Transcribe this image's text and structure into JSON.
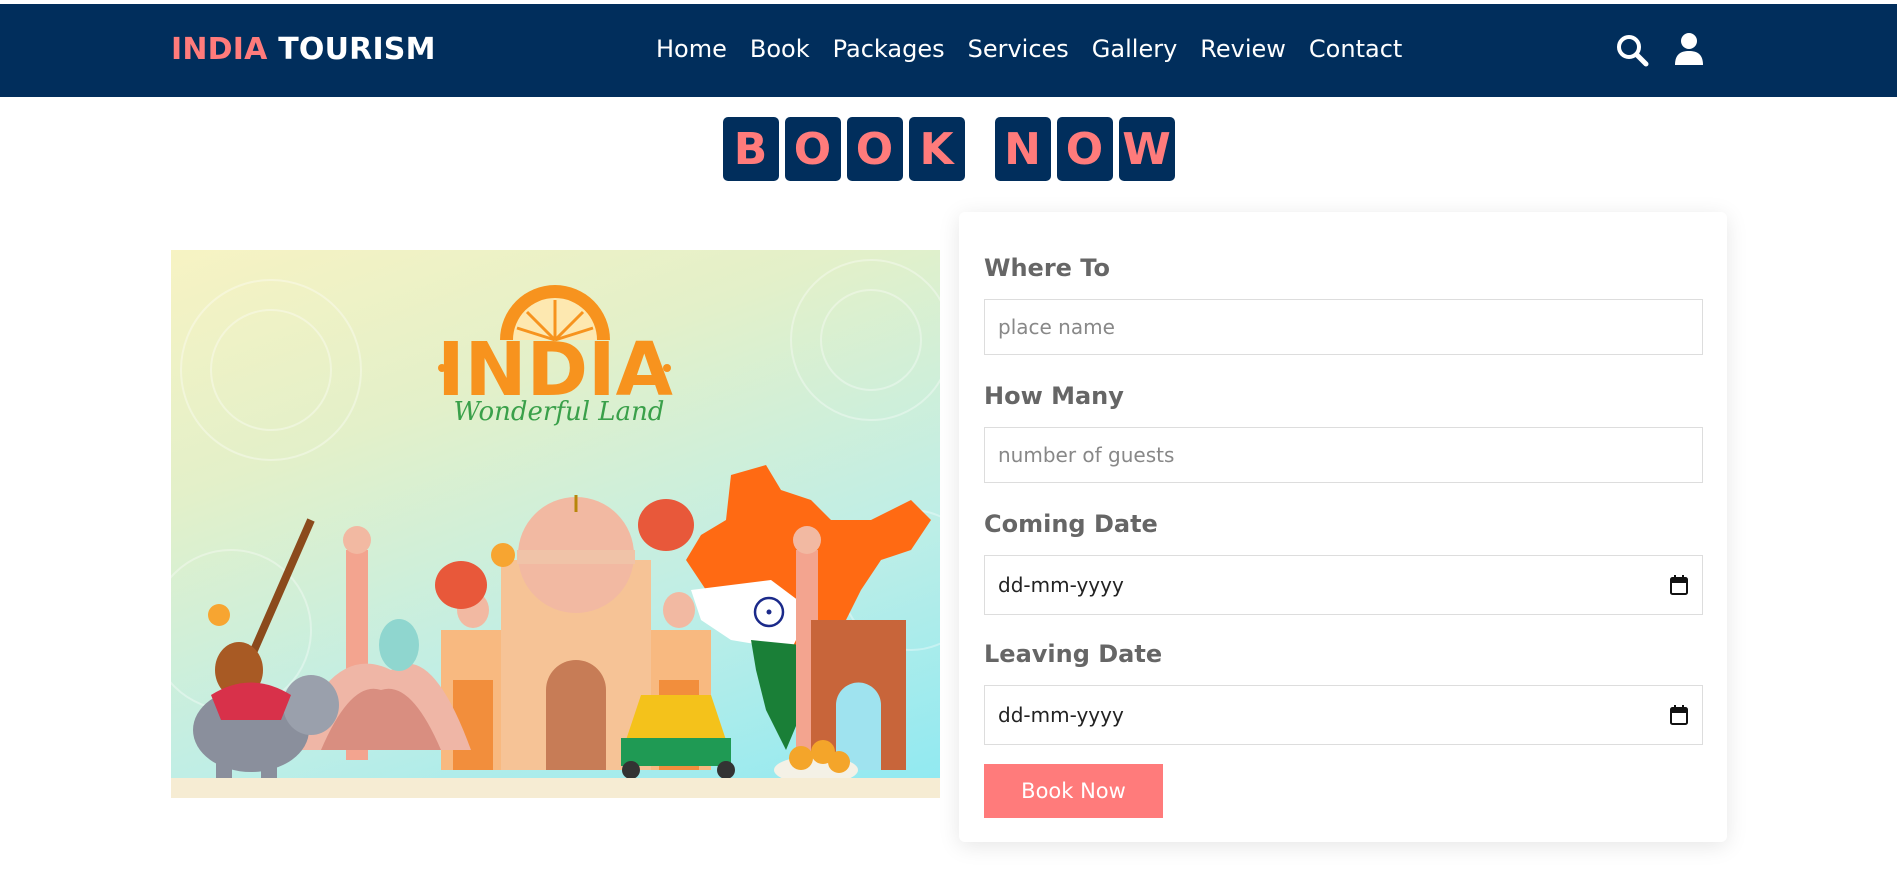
{
  "brand": {
    "accent": "INDIA",
    "main": "TOURISM"
  },
  "nav": [
    "Home",
    "Book",
    "Packages",
    "Services",
    "Gallery",
    "Review",
    "Contact"
  ],
  "header_icons": [
    "search-icon",
    "user-icon"
  ],
  "heading_letters": [
    "B",
    "O",
    "O",
    "K",
    " ",
    "N",
    "O",
    "W"
  ],
  "illustration": {
    "title": "INDIA",
    "subtitle": "Wonderful Land"
  },
  "form": {
    "where_label": "Where To",
    "where_placeholder": "place name",
    "how_many_label": "How Many",
    "how_many_placeholder": "number of guests",
    "coming_label": "Coming Date",
    "coming_value": "dd-mm-yyyy",
    "leaving_label": "Leaving Date",
    "leaving_value": "dd-mm-yyyy",
    "submit_label": "Book Now"
  },
  "colors": {
    "navy": "#012e5c",
    "accent": "#ff7b7b",
    "label": "#666666"
  }
}
